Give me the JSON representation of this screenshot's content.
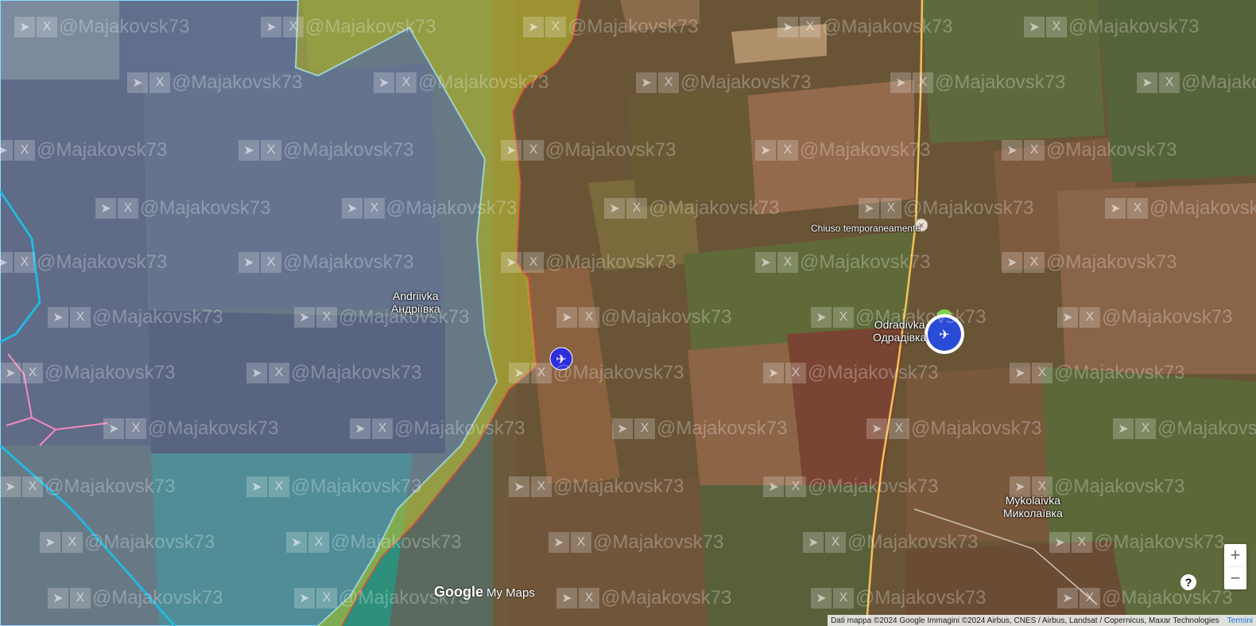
{
  "places": [
    {
      "name": "Andriivka",
      "name_uk": "Андріївка"
    },
    {
      "name": "Odradivka",
      "name_uk": "Одрадівка"
    },
    {
      "name": "Mykolaivka",
      "name_uk": "Миколаївка"
    }
  ],
  "poi": {
    "label": "Chiuso temporaneamente",
    "icon": "food-icon"
  },
  "watermark": {
    "handle": "@Majakovsk73",
    "icon": "telegram-icon",
    "icon2": "x-icon"
  },
  "controls": {
    "zoom_in": "+",
    "zoom_out": "−",
    "help": "?"
  },
  "branding": {
    "google": "Google",
    "my_maps": "My Maps"
  },
  "attribution": {
    "text": "Dati mappa ©2024 Google Immagini ©2024 Airbus, CNES / Airbus, Landsat / Copernicus, Maxar Technologies",
    "terms": "Termini"
  },
  "markers": [
    {
      "type": "drone-icon",
      "color": "#2e2edb"
    },
    {
      "type": "drone-unit-icon",
      "color": "#2a4bd6",
      "ring": "#ffffff",
      "flag": "#7ad34a"
    }
  ],
  "colors": {
    "occupied_area": "#7a8cb8",
    "contested_area": "#c4c430",
    "frontline_blue": "#8fd8ff",
    "frontline_red": "#e0483a",
    "road": "#f2c15a",
    "canal": "#22b8e0",
    "pink_lines": "#f58ac0"
  }
}
